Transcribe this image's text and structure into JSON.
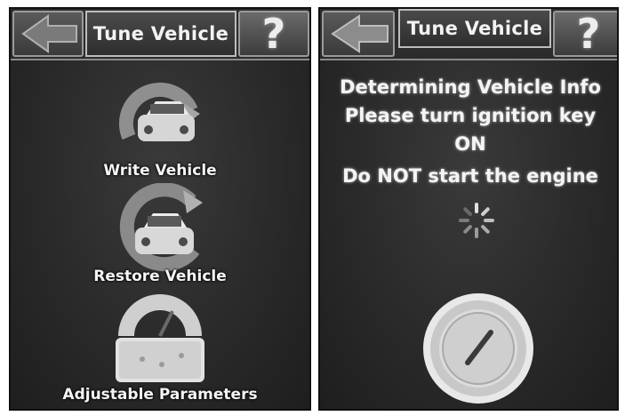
{
  "left_screen": {
    "header": {
      "back_icon": "back-arrow-icon",
      "title": "Tune Vehicle",
      "help_label": "?"
    },
    "menu": [
      {
        "label": "Write Vehicle",
        "icon": "write-vehicle-icon"
      },
      {
        "label": "Restore Vehicle",
        "icon": "restore-vehicle-icon"
      },
      {
        "label": "Adjustable Parameters",
        "icon": "adjustable-parameters-icon"
      }
    ]
  },
  "right_screen": {
    "header": {
      "back_icon": "back-arrow-icon",
      "title": "Tune Vehicle",
      "help_label": "?"
    },
    "message": {
      "line1": "Determining Vehicle Info",
      "line2": "Please turn ignition key",
      "line3": "ON",
      "line4": "Do NOT start the engine"
    },
    "spinner_icon": "loading-spinner-icon",
    "ignition_icon": "ignition-key-icon"
  }
}
